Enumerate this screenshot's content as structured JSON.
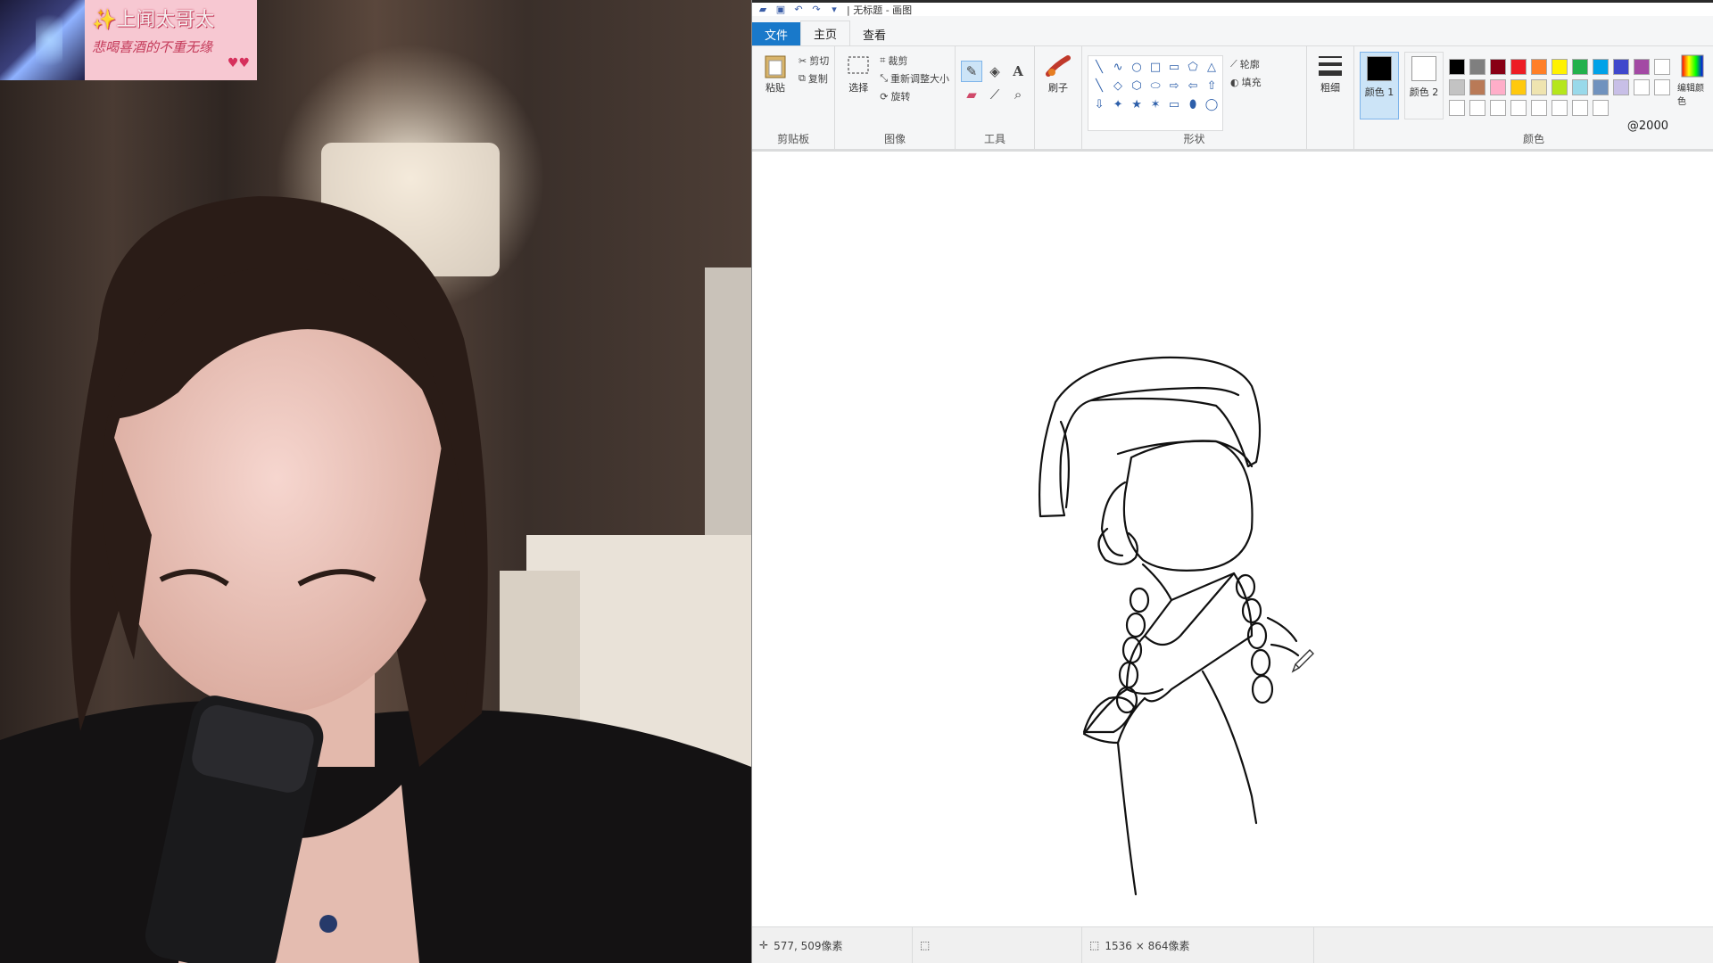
{
  "overlay": {
    "title": "✨上闻太哥太",
    "subtitle": "悲喝喜酒的不重无缘",
    "heart": "♥♥"
  },
  "paint": {
    "qat": [
      "save-icon",
      "undo-icon",
      "redo-icon"
    ],
    "window_title": "| 无标题 - 画图",
    "tabs": {
      "file": "文件",
      "home": "主页",
      "view": "查看"
    },
    "clipboard": {
      "paste": "粘贴",
      "cut": "剪切",
      "copy": "复制",
      "label": "剪贴板"
    },
    "image": {
      "select": "选择",
      "crop": "裁剪",
      "resize": "重新调整大小",
      "rotate": "旋转",
      "label": "图像"
    },
    "tools": {
      "label": "工具"
    },
    "brushes": {
      "label": "刷子"
    },
    "shapes": {
      "outline": "轮廓",
      "fill": "填充",
      "label": "形状",
      "glyphs": [
        "╲",
        "∿",
        "○",
        "□",
        "▭",
        "⬠",
        "△",
        "╲",
        "◇",
        "⬡",
        "⬭",
        "⇨",
        "⇦",
        "⇧",
        "⇩",
        "✦",
        "★",
        "✶",
        "▭",
        "⬮",
        "◯"
      ]
    },
    "size": {
      "label": "粗细"
    },
    "colors": {
      "color1": "颜色 1",
      "color2": "颜色 2",
      "edit": "编辑颜色",
      "label": "颜色",
      "color1_hex": "#000000",
      "color2_hex": "#ffffff",
      "palette": [
        "#000000",
        "#7f7f7f",
        "#880015",
        "#ed1c24",
        "#ff7f27",
        "#fff200",
        "#22b14c",
        "#00a2e8",
        "#3f48cc",
        "#a349a4",
        "#ffffff",
        "#c3c3c3",
        "#b97a57",
        "#ffaec9",
        "#ffc90e",
        "#efe4b0",
        "#b5e61d",
        "#99d9ea",
        "#7092be",
        "#c8bfe7",
        "#ffffff",
        "#ffffff",
        "#ffffff",
        "#ffffff",
        "#ffffff",
        "#ffffff",
        "#ffffff",
        "#ffffff",
        "#ffffff",
        "#ffffff"
      ],
      "palette_caption": "@2000"
    },
    "status": {
      "cursor_pos": "577, 509像素",
      "selection": "",
      "canvas_size": "1536 × 864像素"
    }
  }
}
